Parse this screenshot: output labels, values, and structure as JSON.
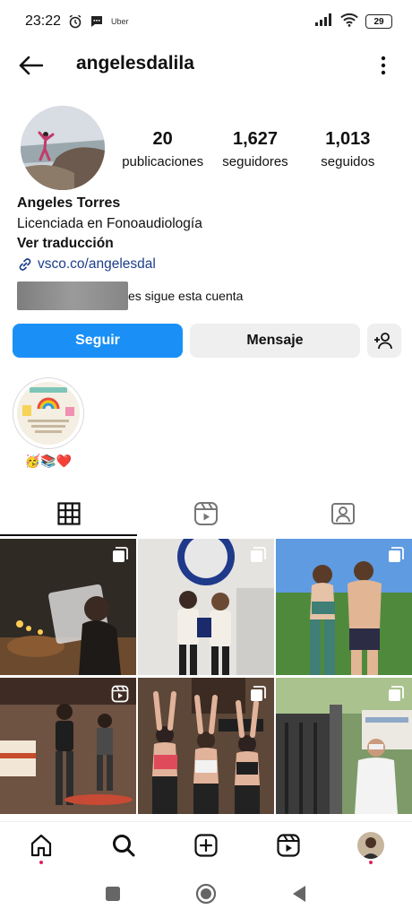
{
  "status_bar": {
    "time": "23:22",
    "notification_text": "Uber",
    "battery": "29"
  },
  "header": {
    "username": "angelesdalila"
  },
  "profile": {
    "stats": [
      {
        "value": "20",
        "label": "publicaciones"
      },
      {
        "value": "1,627",
        "label": "seguidores"
      },
      {
        "value": "1,013",
        "label": "seguidos"
      }
    ],
    "name": "Angeles Torres",
    "bio": "Licenciada en Fonoaudiología",
    "translate_label": "Ver traducción",
    "link": "vsco.co/angelesdal",
    "followed_by_text": "es sigue esta cuenta"
  },
  "actions": {
    "follow_label": "Seguir",
    "message_label": "Mensaje"
  },
  "highlights": [
    {
      "label": "🥳📚❤️"
    }
  ],
  "colors": {
    "accent": "#1a90f6",
    "button_bg": "#efefef",
    "link": "#1c3d8a",
    "notification_dot": "#e0245e"
  },
  "tabs": [
    "grid-icon",
    "reels-icon",
    "tagged-icon"
  ],
  "grid_posts": [
    {
      "icon": "carousel-icon"
    },
    {
      "icon": "carousel-icon"
    },
    {
      "icon": "carousel-icon"
    },
    {
      "icon": "reel-icon"
    },
    {
      "icon": "carousel-icon"
    },
    {
      "icon": "carousel-icon"
    }
  ],
  "bottom_nav": [
    "home-icon",
    "search-icon",
    "create-icon",
    "reels-icon",
    "profile-avatar"
  ]
}
